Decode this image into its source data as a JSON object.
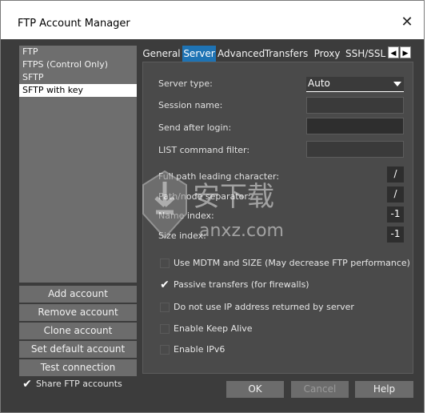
{
  "window": {
    "title": "FTP Account Manager",
    "close_glyph": "✕"
  },
  "accounts": {
    "items": [
      "FTP",
      "FTPS (Control Only)",
      "SFTP",
      "SFTP with key"
    ],
    "selected_index": 3
  },
  "actions": {
    "add": "Add account",
    "remove": "Remove account",
    "clone": "Clone account",
    "set_default": "Set default account",
    "test": "Test connection"
  },
  "share": {
    "label": "Share FTP accounts",
    "checked": true
  },
  "tabs": {
    "items": [
      "General",
      "Server",
      "Advanced",
      "Transfers",
      "Proxy",
      "SSH/SSL"
    ],
    "active": "Server",
    "scroll_left": "◀",
    "scroll_right": "▶"
  },
  "server": {
    "server_type_label": "Server type:",
    "server_type_value": "Auto",
    "session_name_label": "Session name:",
    "send_after_login_label": "Send after login:",
    "list_filter_label": "LIST command filter:",
    "full_path_label": "Full path leading character:",
    "full_path_value": "/",
    "path_sep_label": "Path/node separator:",
    "path_sep_value": "/",
    "name_index_label": "Name index:",
    "name_index_value": "-1",
    "size_index_label": "Size index:",
    "size_index_value": "-1",
    "options": [
      {
        "label": "Use MDTM and SIZE (May decrease FTP performance)",
        "checked": false
      },
      {
        "label": "Passive transfers (for firewalls)",
        "checked": true
      },
      {
        "label": "Do not use IP address returned by server",
        "checked": false
      },
      {
        "label": "Enable Keep Alive",
        "checked": false
      },
      {
        "label": "Enable IPv6",
        "checked": false
      }
    ]
  },
  "footer": {
    "ok": "OK",
    "cancel": "Cancel",
    "help": "Help"
  },
  "watermark": {
    "text": "安下载",
    "sub": "anxz.com"
  },
  "colors": {
    "accent": "#1e73b4",
    "background": "#3c3c3c",
    "panel": "#4a4a4a"
  }
}
